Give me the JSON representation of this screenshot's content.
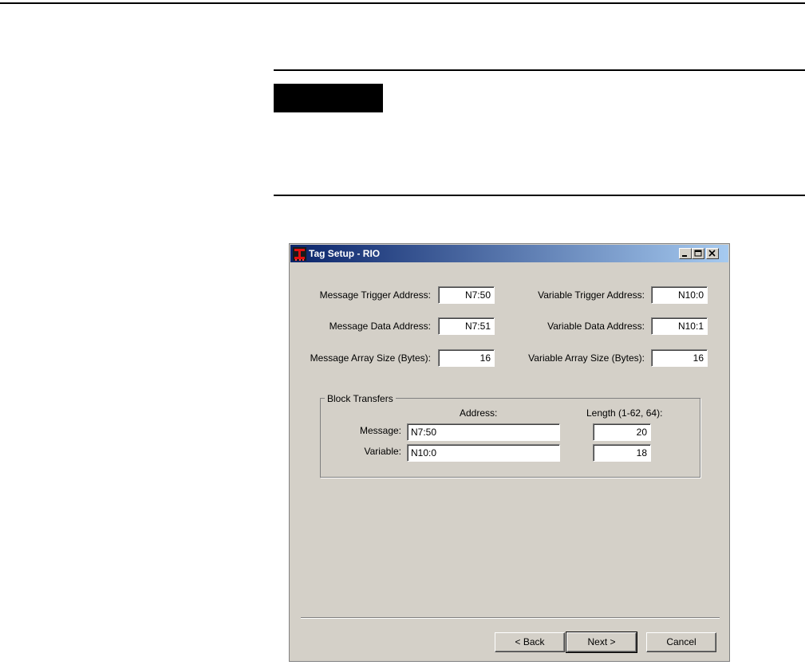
{
  "dialog": {
    "title": "Tag Setup - RIO",
    "message_trigger_label": "Message Trigger Address:",
    "message_trigger_value": "N7:50",
    "message_data_label": "Message Data Address:",
    "message_data_value": "N7:51",
    "message_array_label": "Message Array Size (Bytes):",
    "message_array_value": "16",
    "variable_trigger_label": "Variable Trigger Address:",
    "variable_trigger_value": "N10:0",
    "variable_data_label": "Variable Data Address:",
    "variable_data_value": "N10:1",
    "variable_array_label": "Variable Array Size (Bytes):",
    "variable_array_value": "16"
  },
  "block_transfers": {
    "title": "Block Transfers",
    "address_header": "Address:",
    "length_header": "Length (1-62, 64):",
    "message_label": "Message:",
    "message_address": "N7:50",
    "message_length": "20",
    "variable_label": "Variable:",
    "variable_address": "N10:0",
    "variable_length": "18"
  },
  "buttons": {
    "back": "< Back",
    "next": "Next >",
    "cancel": "Cancel"
  },
  "icons": {
    "app": "tag-app-icon",
    "minimize": "minimize-icon",
    "maximize": "maximize-icon",
    "close": "close-icon"
  },
  "colors": {
    "titlebar_start": "#0a246a",
    "titlebar_end": "#a6caf0",
    "dialog_bg": "#d4d0c8"
  }
}
